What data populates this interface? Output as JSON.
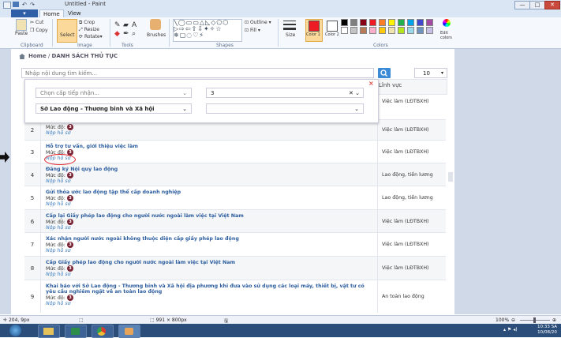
{
  "window": {
    "title": "Untitled - Paint",
    "tabs": [
      "Home",
      "View"
    ],
    "min": "—",
    "max": "□",
    "close": "✕"
  },
  "ribbon": {
    "clipboard": {
      "paste": "Paste",
      "cut": "Cut",
      "copy": "Copy",
      "label": "Clipboard"
    },
    "image": {
      "select": "Select",
      "crop": "Crop",
      "resize": "Resize",
      "rotate": "Rotate",
      "label": "Image"
    },
    "tools": {
      "label": "Tools"
    },
    "brushes": "Brushes",
    "shapes": {
      "outline": "Outline",
      "fill": "Fill",
      "label": "Shapes"
    },
    "size": "Size",
    "color1": "Color 1",
    "color2": "Color 2",
    "edit_colors": "Edit colors",
    "colors_label": "Colors",
    "palette": [
      "#000000",
      "#7f7f7f",
      "#880015",
      "#ed1c24",
      "#ff7f27",
      "#fff200",
      "#22b14c",
      "#00a2e8",
      "#3f48cc",
      "#a349a4",
      "#ffffff",
      "#c3c3c3",
      "#b97a57",
      "#ffaec9",
      "#ffc90e",
      "#efe4b0",
      "#b5e61d",
      "#99d9ea",
      "#7092be",
      "#c8bfe7"
    ],
    "color1_hex": "#ed1c24"
  },
  "page": {
    "breadcrumb_home": "Home",
    "breadcrumb_sep": "/",
    "breadcrumb_current": "DANH SÁCH THỦ TỤC",
    "search_placeholder": "Nhập nội dung tìm kiếm...",
    "page_size": "10",
    "filter": {
      "agency_placeholder": "Chọn cấp tiếp nhận...",
      "department": "Sở Lao động - Thương binh và Xã hội",
      "level_value": "3",
      "blank_select": ""
    },
    "column_field": "Lĩnh vực",
    "level_label": "Mức độ:",
    "submit_label": "Nộp hồ sơ",
    "rows": [
      {
        "num": "",
        "title": "",
        "level": "",
        "field": "Việc làm (LĐTBXH)"
      },
      {
        "num": "2",
        "title": "",
        "level": "3",
        "field": "Việc làm (LĐTBXH)"
      },
      {
        "num": "3",
        "title": "Hỗ trợ tư vấn, giới thiệu việc làm",
        "level": "3",
        "field": "Việc làm (LĐTBXH)"
      },
      {
        "num": "4",
        "title": "Đăng ký Nội quy lao động",
        "level": "3",
        "field": "Lao động, tiền lương"
      },
      {
        "num": "5",
        "title": "Gửi thỏa ước lao động tập thể cấp doanh nghiệp",
        "level": "3",
        "field": "Lao động, tiền lương"
      },
      {
        "num": "6",
        "title": "Cấp lại Giấy phép lao động cho người nước ngoài làm việc tại Việt Nam",
        "level": "3",
        "field": "Việc làm (LĐTBXH)"
      },
      {
        "num": "7",
        "title": "Xác nhận người nước ngoài không thuộc diện cấp giấy phép lao động",
        "level": "3",
        "field": "Việc làm (LĐTBXH)"
      },
      {
        "num": "8",
        "title": "Cấp Giấy phép lao động cho người nước ngoài làm việc tại Việt Nam",
        "level": "3",
        "field": "Việc làm (LĐTBXH)"
      },
      {
        "num": "9",
        "title": "Khai báo với Sở Lao động - Thương binh và Xã hội địa phương khi đưa vào sử dụng các loại máy, thiết bị, vật tư có yêu cầu nghiêm ngặt về an toàn lao động",
        "level": "3",
        "field": "An toàn lao động"
      }
    ]
  },
  "status": {
    "cursor": "204, 9px",
    "size": "991 × 800px",
    "zoom": "100%",
    "time": "10:33 SA",
    "date": "10/08/20"
  }
}
